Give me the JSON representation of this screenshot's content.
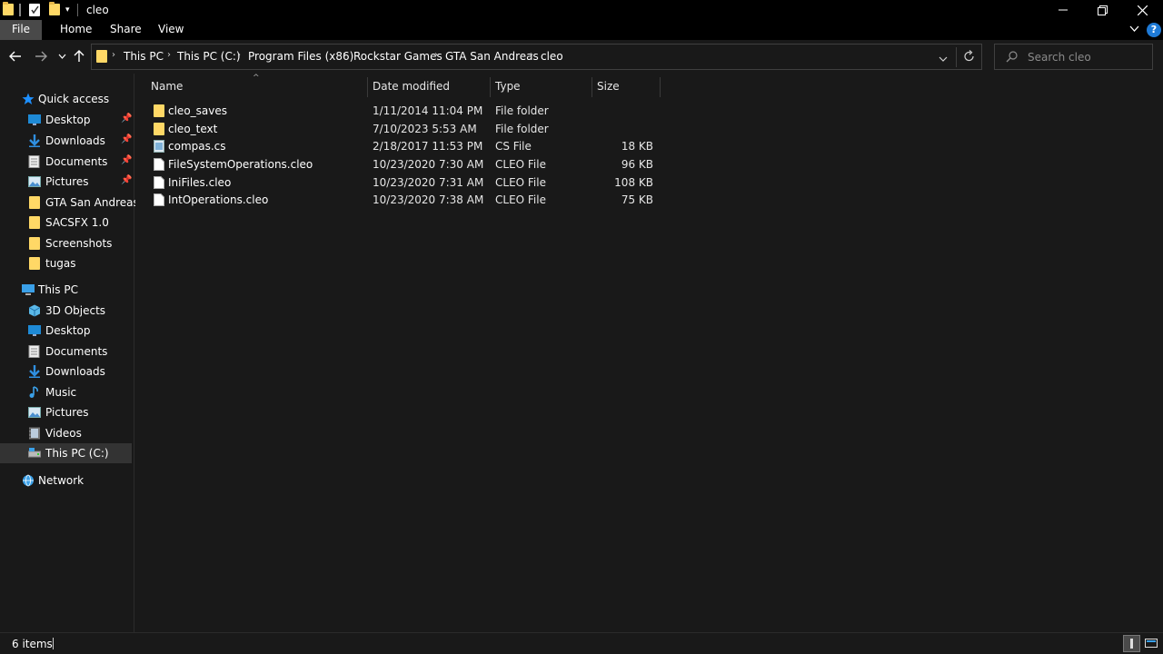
{
  "window": {
    "title": "cleo"
  },
  "ribbon": {
    "tabs": [
      {
        "label": "File"
      },
      {
        "label": "Home"
      },
      {
        "label": "Share"
      },
      {
        "label": "View"
      }
    ]
  },
  "address": {
    "breadcrumbs": [
      {
        "label": "This PC"
      },
      {
        "label": "This PC (C:)"
      },
      {
        "label": "Program Files (x86)"
      },
      {
        "label": "Rockstar Games"
      },
      {
        "label": "GTA San Andreas"
      },
      {
        "label": "cleo"
      }
    ]
  },
  "search": {
    "placeholder": "Search cleo"
  },
  "nav": {
    "quick_access": "Quick access",
    "quick_items": [
      {
        "label": "Desktop",
        "icon": "desktop-icon"
      },
      {
        "label": "Downloads",
        "icon": "downloads-icon"
      },
      {
        "label": "Documents",
        "icon": "documents-icon"
      },
      {
        "label": "Pictures",
        "icon": "pictures-icon"
      },
      {
        "label": "GTA San Andreas",
        "icon": "folder-icon"
      },
      {
        "label": "SACSFX 1.0",
        "icon": "folder-icon"
      },
      {
        "label": "Screenshots",
        "icon": "folder-icon"
      },
      {
        "label": "tugas",
        "icon": "folder-icon"
      }
    ],
    "this_pc": "This PC",
    "pc_items": [
      {
        "label": "3D Objects",
        "icon": "3d-objects-icon"
      },
      {
        "label": "Desktop",
        "icon": "desktop-icon"
      },
      {
        "label": "Documents",
        "icon": "documents-icon"
      },
      {
        "label": "Downloads",
        "icon": "downloads-icon"
      },
      {
        "label": "Music",
        "icon": "music-icon"
      },
      {
        "label": "Pictures",
        "icon": "pictures-icon"
      },
      {
        "label": "Videos",
        "icon": "videos-icon"
      },
      {
        "label": "This PC (C:)",
        "icon": "drive-icon"
      }
    ],
    "network": "Network"
  },
  "columns": {
    "name": "Name",
    "date": "Date modified",
    "type": "Type",
    "size": "Size"
  },
  "files": [
    {
      "name": "cleo_saves",
      "date": "1/11/2014 11:04 PM",
      "type": "File folder",
      "size": "",
      "icon": "folder-icon"
    },
    {
      "name": "cleo_text",
      "date": "7/10/2023 5:53 AM",
      "type": "File folder",
      "size": "",
      "icon": "folder-icon"
    },
    {
      "name": "compas.cs",
      "date": "2/18/2017 11:53 PM",
      "type": "CS File",
      "size": "18 KB",
      "icon": "cs-file-icon"
    },
    {
      "name": "FileSystemOperations.cleo",
      "date": "10/23/2020 7:30 AM",
      "type": "CLEO File",
      "size": "96 KB",
      "icon": "file-icon"
    },
    {
      "name": "IniFiles.cleo",
      "date": "10/23/2020 7:31 AM",
      "type": "CLEO File",
      "size": "108 KB",
      "icon": "file-icon"
    },
    {
      "name": "IntOperations.cleo",
      "date": "10/23/2020 7:38 AM",
      "type": "CLEO File",
      "size": "75 KB",
      "icon": "file-icon"
    }
  ],
  "status": {
    "item_count": "6 items"
  },
  "colors": {
    "background": "#191919",
    "titlebar": "#000000",
    "active_tab": "#494949",
    "selected": "#333333",
    "folder": "#ffd866",
    "accent": "#1e90ff"
  }
}
